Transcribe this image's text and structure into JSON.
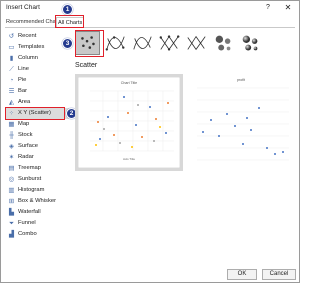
{
  "window": {
    "title": "Insert Chart",
    "help": "?",
    "close": "✕"
  },
  "tabs": [
    {
      "label": "Recommended Charts"
    },
    {
      "label": "All Charts"
    }
  ],
  "sidebar": {
    "items": [
      {
        "label": "Recent",
        "icon": "recent-icon"
      },
      {
        "label": "Templates",
        "icon": "templates-icon"
      },
      {
        "label": "Column",
        "icon": "column-icon"
      },
      {
        "label": "Line",
        "icon": "line-icon"
      },
      {
        "label": "Pie",
        "icon": "pie-icon"
      },
      {
        "label": "Bar",
        "icon": "bar-icon"
      },
      {
        "label": "Area",
        "icon": "area-icon"
      },
      {
        "label": "X Y (Scatter)",
        "icon": "scatter-icon",
        "selected": true
      },
      {
        "label": "Map",
        "icon": "map-icon"
      },
      {
        "label": "Stock",
        "icon": "stock-icon"
      },
      {
        "label": "Surface",
        "icon": "surface-icon"
      },
      {
        "label": "Radar",
        "icon": "radar-icon"
      },
      {
        "label": "Treemap",
        "icon": "treemap-icon"
      },
      {
        "label": "Sunburst",
        "icon": "sunburst-icon"
      },
      {
        "label": "Histogram",
        "icon": "histogram-icon"
      },
      {
        "label": "Box & Whisker",
        "icon": "box-whisker-icon"
      },
      {
        "label": "Waterfall",
        "icon": "waterfall-icon"
      },
      {
        "label": "Funnel",
        "icon": "funnel-icon"
      },
      {
        "label": "Combo",
        "icon": "combo-icon"
      }
    ]
  },
  "subtypes": [
    {
      "name": "scatter-subtype",
      "selected": true
    },
    {
      "name": "scatter-smooth-lines-markers-subtype"
    },
    {
      "name": "scatter-smooth-lines-subtype"
    },
    {
      "name": "scatter-straight-lines-markers-subtype"
    },
    {
      "name": "scatter-straight-lines-subtype"
    },
    {
      "name": "bubble-subtype"
    },
    {
      "name": "bubble-3d-subtype"
    }
  ],
  "section": {
    "title": "Scatter"
  },
  "previews": [
    {
      "title": "Chart Title",
      "axis_label": "Axis Title"
    },
    {
      "title": "profit"
    }
  ],
  "annotations": {
    "badge1": "1",
    "badge2": "2",
    "badge3": "3"
  },
  "buttons": {
    "ok": "OK",
    "cancel": "Cancel"
  },
  "colors": {
    "highlight": "#e0202a",
    "badge": "#243a8f",
    "series_blue": "#4472c4",
    "series_orange": "#ed7d31",
    "series_gray": "#a5a5a5",
    "series_yellow": "#ffc000"
  }
}
